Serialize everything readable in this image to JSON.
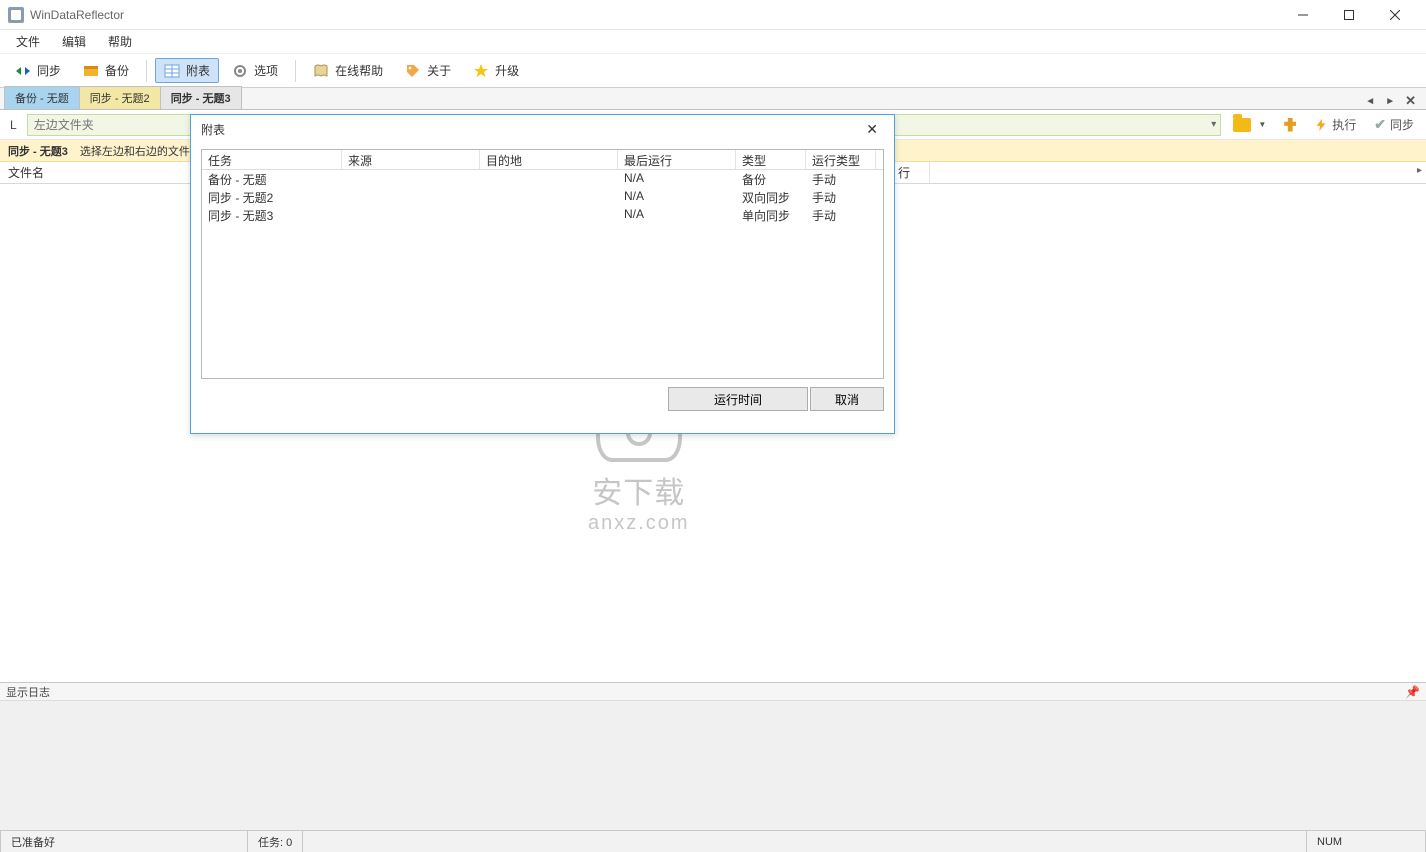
{
  "window": {
    "title": "WinDataReflector"
  },
  "menu": {
    "file": "文件",
    "edit": "编辑",
    "help": "帮助"
  },
  "toolbar": {
    "sync": "同步",
    "backup": "备份",
    "attach": "附表",
    "options": "选项",
    "onlinehelp": "在线帮助",
    "about": "关于",
    "upgrade": "升级"
  },
  "tabs": [
    {
      "label": "备份 - 无题"
    },
    {
      "label": "同步 - 无题2"
    },
    {
      "label": "同步 - 无题3"
    }
  ],
  "pathbar": {
    "L": "L",
    "left_placeholder": "左边文件夹",
    "run": "执行",
    "sync_action": "同步"
  },
  "info": {
    "task": "同步 - 无题3",
    "hint": "选择左边和右边的文件"
  },
  "grid": {
    "filename": "文件名",
    "action": "行"
  },
  "modal": {
    "title": "附表",
    "headers": {
      "task": "任务",
      "source": "来源",
      "dest": "目的地",
      "last": "最后运行",
      "type": "类型",
      "runtype": "运行类型"
    },
    "rows": [
      {
        "task": "备份 - 无题",
        "source": "",
        "dest": "",
        "last": "N/A",
        "type": "备份",
        "runtype": "手动"
      },
      {
        "task": "同步 - 无题2",
        "source": "",
        "dest": "",
        "last": "N/A",
        "type": "双向同步",
        "runtype": "手动"
      },
      {
        "task": "同步 - 无题3",
        "source": "",
        "dest": "",
        "last": "N/A",
        "type": "单向同步",
        "runtype": "手动"
      }
    ],
    "run_btn": "运行时间",
    "cancel_btn": "取消"
  },
  "log": {
    "title": "显示日志"
  },
  "status": {
    "ready": "已准备好",
    "tasks": "任务: 0",
    "num": "NUM"
  },
  "watermark": {
    "line1": "安下载",
    "line2": "anxz.com"
  }
}
